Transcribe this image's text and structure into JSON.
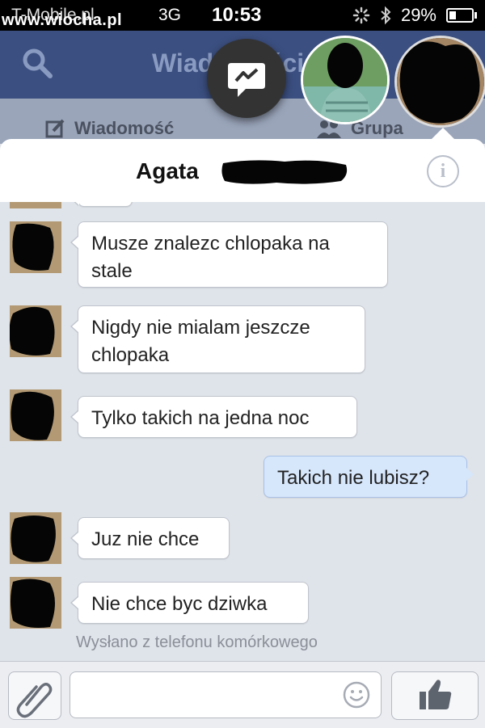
{
  "status_bar": {
    "carrier": "T-Mobile.pl",
    "watermark": "www.wiocha.pl",
    "network": "3G",
    "time": "10:53",
    "battery": "29%",
    "battery_level": 0.29
  },
  "background_app": {
    "title": "Wiadomości",
    "tab_message": "Wiadomość",
    "tab_group": "Grupa"
  },
  "header": {
    "contact_name": "Agata"
  },
  "messages": [
    {
      "direction": "in",
      "text_line1": "Musze znalezc chlopaka na",
      "text_line2": "stale"
    },
    {
      "direction": "in",
      "text_line1": "Nigdy nie mialam jeszcze",
      "text_line2": "chlopaka"
    },
    {
      "direction": "in",
      "text_line1": "Tylko takich na jedna noc"
    },
    {
      "direction": "out",
      "text_line1": "Takich nie lubisz?"
    },
    {
      "direction": "in",
      "text_line1": "Juz nie chce"
    },
    {
      "direction": "in",
      "text_line1": "Nie chce byc dziwka"
    }
  ],
  "sent_note": "Wysłano z telefonu komórkowego",
  "composer": {
    "placeholder": ""
  },
  "colors": {
    "nav_blue": "#3b4f80",
    "outgoing_bubble": "#d6e6fb",
    "conversation_bg": "#dfe3ea"
  }
}
